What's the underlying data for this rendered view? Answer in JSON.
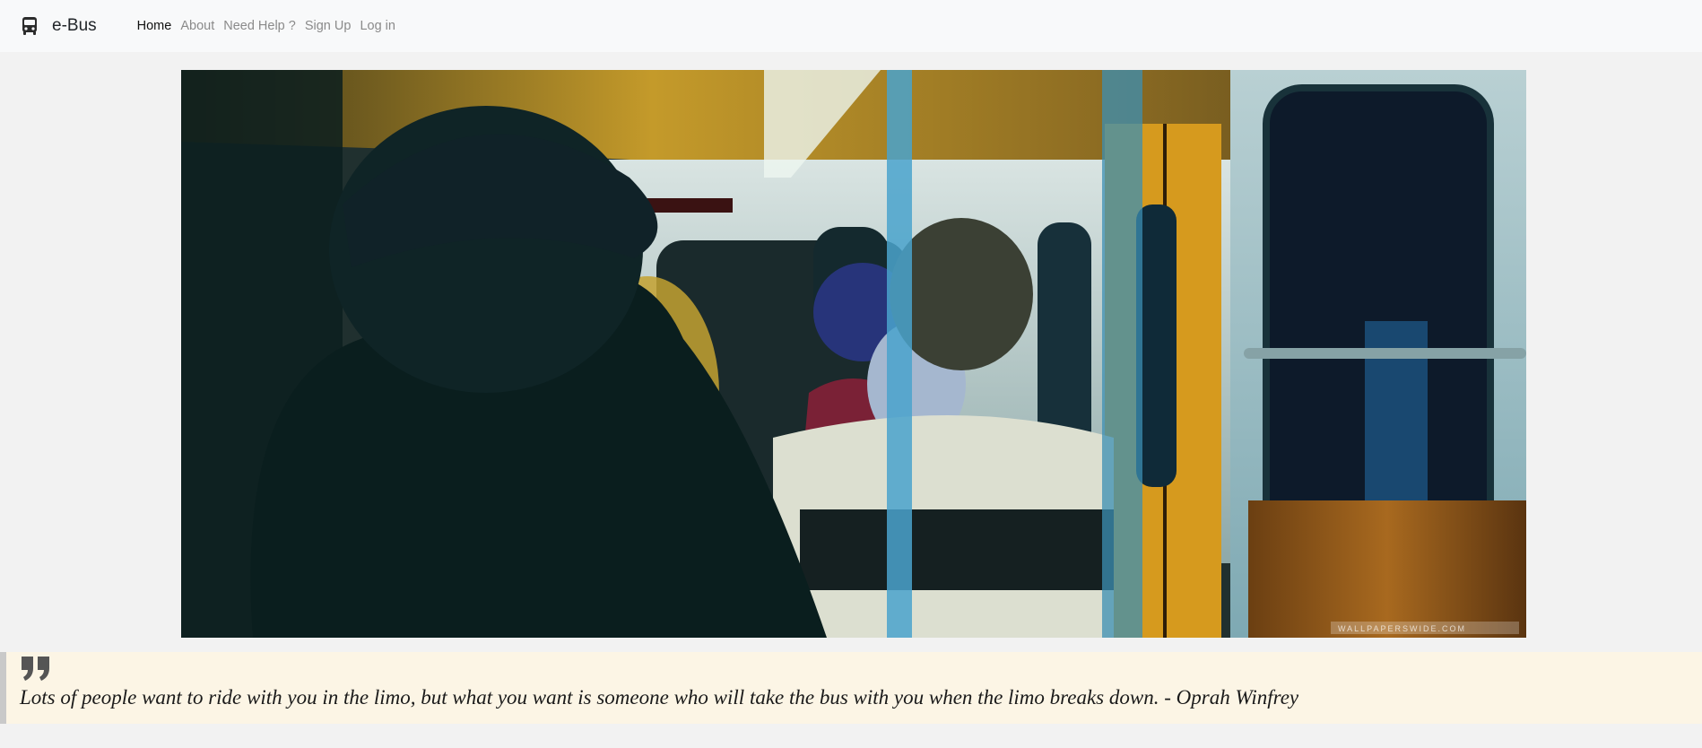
{
  "brand": {
    "icon": "bus-icon",
    "name": "e-Bus"
  },
  "nav": {
    "items": [
      {
        "label": "Home",
        "active": true
      },
      {
        "label": "About",
        "active": false
      },
      {
        "label": "Need Help ?",
        "active": false
      },
      {
        "label": "Sign Up",
        "active": false
      },
      {
        "label": "Log in",
        "active": false
      }
    ]
  },
  "hero": {
    "description": "Photo of passengers inside a bus / metro car",
    "watermark": "WALLPAPERSWIDE.COM"
  },
  "quote": {
    "icon": "quote-icon",
    "text": "Lots of people want to ride with you in the limo, but what you want is someone who will take the bus with you when the limo breaks down. - Oprah Winfrey"
  },
  "colors": {
    "navbar_bg": "#f8f9fa",
    "page_bg": "#f2f2f2",
    "quote_bg": "#fcf5e5",
    "quote_border": "#c9c9c9"
  }
}
